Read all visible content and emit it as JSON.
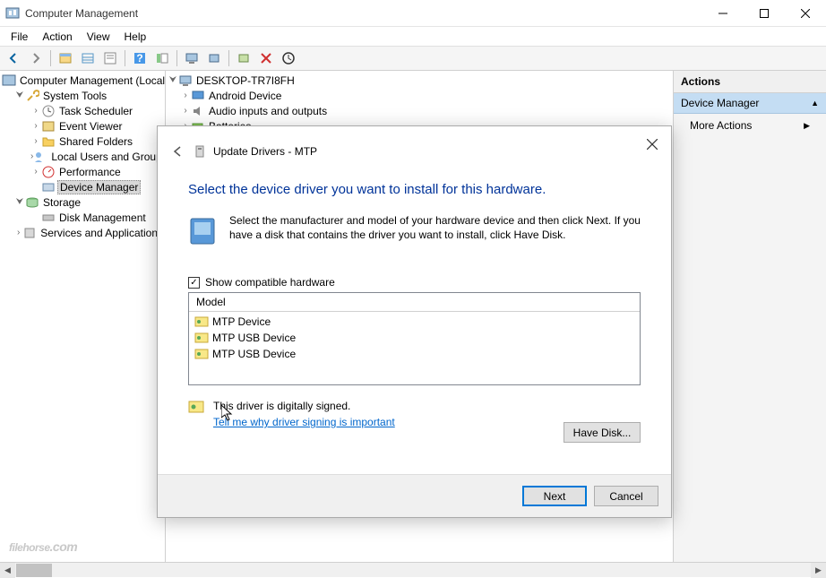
{
  "window": {
    "title": "Computer Management"
  },
  "menubar": [
    "File",
    "Action",
    "View",
    "Help"
  ],
  "left_tree": {
    "root": "Computer Management (Local",
    "system_tools": "System Tools",
    "st_items": [
      "Task Scheduler",
      "Event Viewer",
      "Shared Folders",
      "Local Users and Groups",
      "Performance",
      "Device Manager"
    ],
    "storage": "Storage",
    "storage_items": [
      "Disk Management"
    ],
    "services": "Services and Applications"
  },
  "center_tree": {
    "root": "DESKTOP-TR7I8FH",
    "items": [
      "Android Device",
      "Audio inputs and outputs",
      "Batteries"
    ]
  },
  "actions_pane": {
    "header": "Actions",
    "sub": "Device Manager",
    "item": "More Actions"
  },
  "dialog": {
    "title": "Update Drivers - MTP",
    "headline": "Select the device driver you want to install for this hardware.",
    "instructions": "Select the manufacturer and model of your hardware device and then click Next. If you have a disk that contains the driver you want to install, click Have Disk.",
    "checkbox": "Show compatible hardware",
    "model_header": "Model",
    "models": [
      "MTP Device",
      "MTP USB Device",
      "MTP USB Device"
    ],
    "signed_text": "This driver is digitally signed.",
    "link_text": "Tell me why driver signing is important",
    "have_disk": "Have Disk...",
    "next": "Next",
    "cancel": "Cancel"
  },
  "watermark": {
    "main": "filehorse",
    "suffix": ".com"
  }
}
